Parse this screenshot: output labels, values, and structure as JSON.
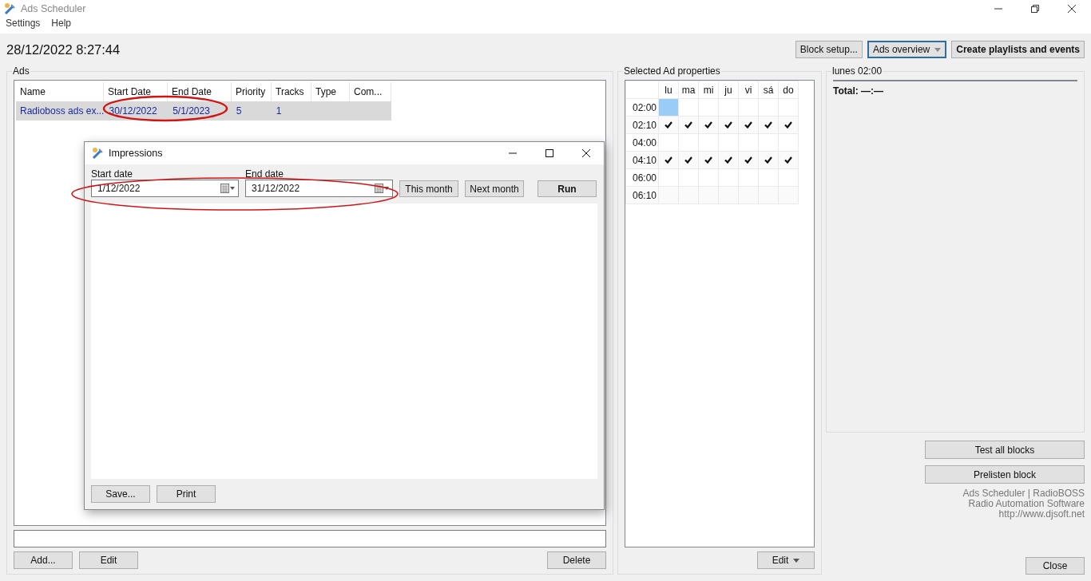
{
  "window": {
    "title": "Ads Scheduler"
  },
  "menu": [
    "Settings",
    "Help"
  ],
  "clock": "28/12/2022 8:27:44",
  "toolbar": [
    {
      "label": "Block setup...",
      "kind": "button"
    },
    {
      "label": "Ads overview",
      "kind": "dropdown",
      "focused": true
    },
    {
      "label": "Create playlists and events",
      "kind": "bold"
    }
  ],
  "ads": {
    "title": "Ads",
    "columns": [
      "Name",
      "Start Date",
      "End Date",
      "Priority",
      "Tracks",
      "Type",
      "Com..."
    ],
    "rows": [
      {
        "cells": [
          "Radioboss ads ex...",
          "30/12/2022",
          "5/1/2023",
          "5",
          "1",
          "",
          ""
        ],
        "selected": true
      }
    ],
    "buttons": [
      "Add...",
      "Edit"
    ],
    "delete_button": "Delete"
  },
  "properties": {
    "title": "Selected Ad properties",
    "days": [
      "lu",
      "ma",
      "mi",
      "ju",
      "vi",
      "sá",
      "do"
    ],
    "rows": [
      {
        "time": "02:00",
        "cells": [
          {
            "checked": false,
            "selected": true
          },
          {
            "checked": false,
            "selected": false
          },
          {
            "checked": false,
            "selected": false
          },
          {
            "checked": false,
            "selected": false
          },
          {
            "checked": false,
            "selected": false
          },
          {
            "checked": false,
            "selected": false
          },
          {
            "checked": false,
            "selected": false
          }
        ]
      },
      {
        "time": "02:10",
        "cells": [
          {
            "checked": true,
            "selected": false
          },
          {
            "checked": true,
            "selected": false
          },
          {
            "checked": true,
            "selected": false
          },
          {
            "checked": true,
            "selected": false
          },
          {
            "checked": true,
            "selected": false
          },
          {
            "checked": true,
            "selected": false
          },
          {
            "checked": true,
            "selected": false
          }
        ]
      },
      {
        "time": "04:00",
        "cells": [
          {
            "checked": false,
            "selected": false
          },
          {
            "checked": false,
            "selected": false
          },
          {
            "checked": false,
            "selected": false
          },
          {
            "checked": false,
            "selected": false
          },
          {
            "checked": false,
            "selected": false
          },
          {
            "checked": false,
            "selected": false
          },
          {
            "checked": false,
            "selected": false
          }
        ]
      },
      {
        "time": "04:10",
        "cells": [
          {
            "checked": true,
            "selected": false
          },
          {
            "checked": true,
            "selected": false
          },
          {
            "checked": true,
            "selected": false
          },
          {
            "checked": true,
            "selected": false
          },
          {
            "checked": true,
            "selected": false
          },
          {
            "checked": true,
            "selected": false
          },
          {
            "checked": true,
            "selected": false
          }
        ]
      },
      {
        "time": "06:00",
        "cells": [
          {
            "checked": false,
            "selected": false
          },
          {
            "checked": false,
            "selected": false
          },
          {
            "checked": false,
            "selected": false
          },
          {
            "checked": false,
            "selected": false
          },
          {
            "checked": false,
            "selected": false
          },
          {
            "checked": false,
            "selected": false
          },
          {
            "checked": false,
            "selected": false
          }
        ]
      },
      {
        "time": "06:10",
        "cells": [
          {
            "checked": false,
            "selected": false
          },
          {
            "checked": false,
            "selected": false
          },
          {
            "checked": false,
            "selected": false
          },
          {
            "checked": false,
            "selected": false
          },
          {
            "checked": false,
            "selected": false
          },
          {
            "checked": false,
            "selected": false
          },
          {
            "checked": false,
            "selected": false
          }
        ]
      }
    ],
    "edit_button": "Edit"
  },
  "block": {
    "title": "lunes 02:00",
    "total": "Total: —:—"
  },
  "side_buttons": [
    "Test all blocks",
    "Prelisten block"
  ],
  "about": [
    "Ads Scheduler | RadioBOSS",
    "Radio Automation Software",
    "http://www.djsoft.net"
  ],
  "close_button": "Close",
  "dialog": {
    "title": "Impressions",
    "start_label": "Start date",
    "start_value": "1/12/2022",
    "end_label": "End date",
    "end_value": "31/12/2022",
    "range_buttons": [
      "This month",
      "Next month"
    ],
    "run_button": "Run",
    "buttons": [
      "Save...",
      "Print"
    ]
  }
}
